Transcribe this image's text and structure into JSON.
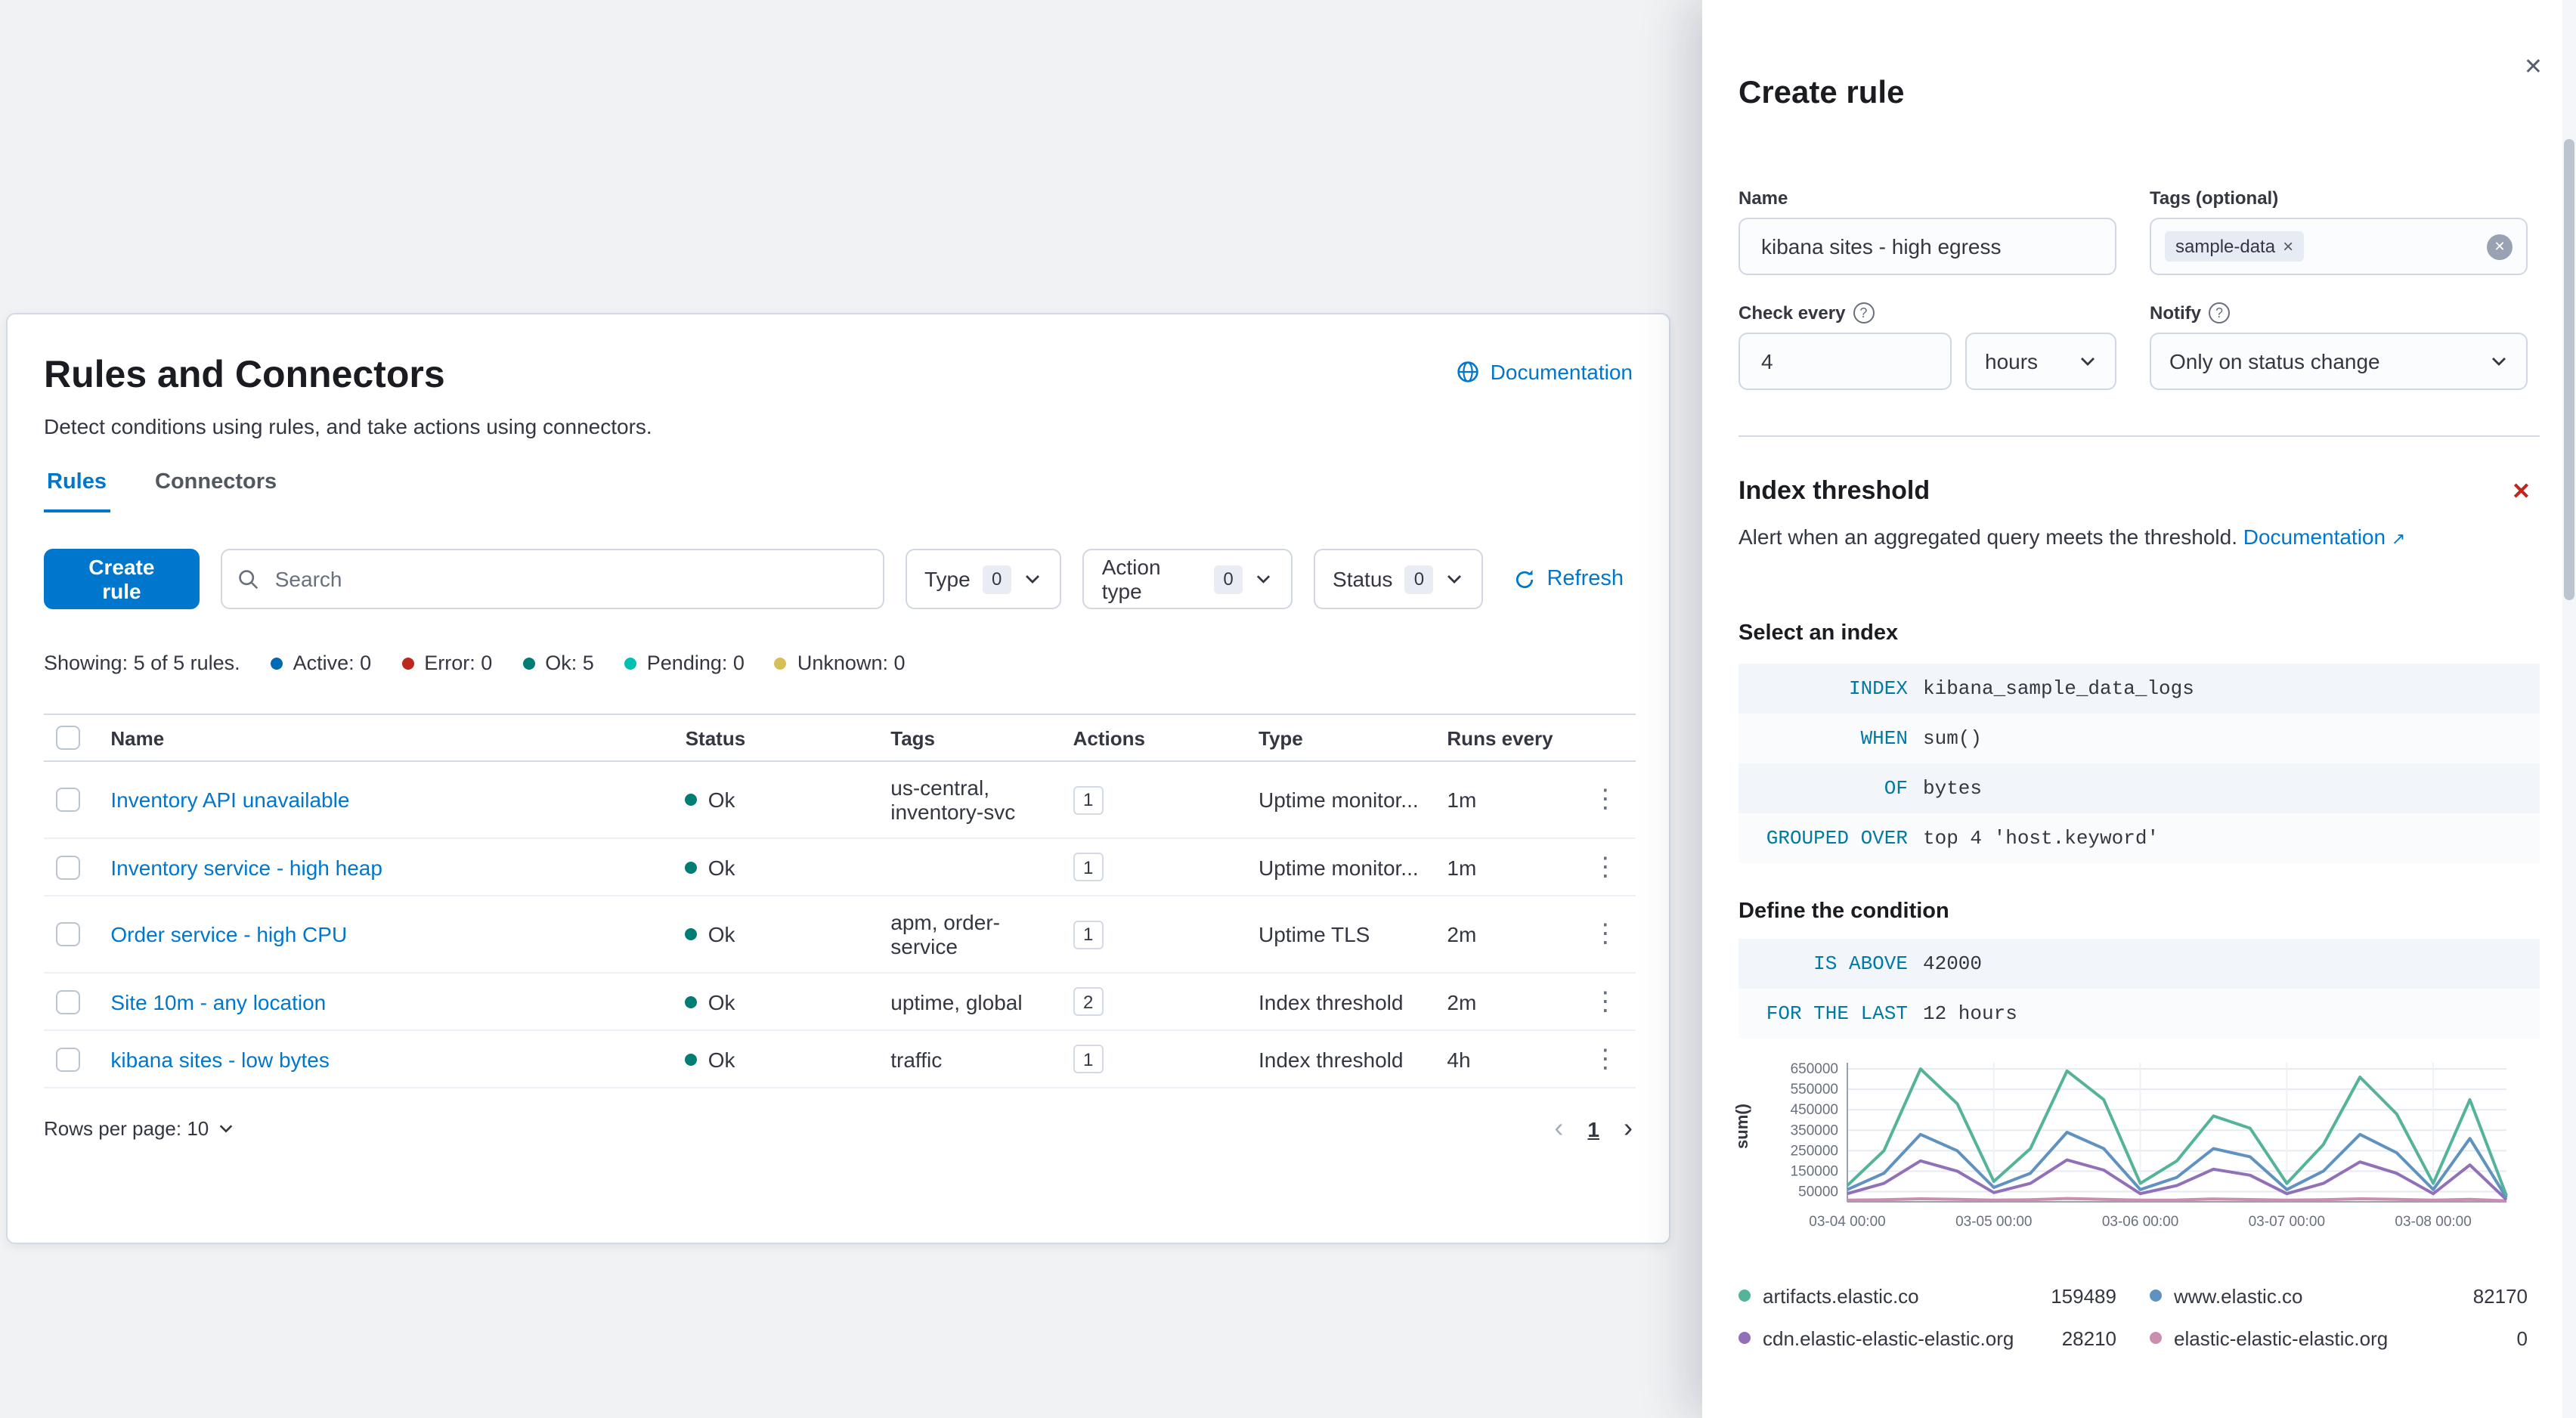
{
  "icons": {
    "close": "✕",
    "remove": "✕",
    "tag_remove": "×",
    "clear": "✕",
    "help": "?",
    "kebab": "⋮",
    "chevron_left": "‹",
    "chevron_right": "›",
    "external": "↗"
  },
  "page": {
    "title": "Rules and Connectors",
    "documentation_label": "Documentation",
    "subtitle": "Detect conditions using rules, and take actions using connectors.",
    "tabs": [
      {
        "label": "Rules"
      },
      {
        "label": "Connectors"
      }
    ],
    "create_rule_button": "Create rule",
    "search_placeholder": "Search",
    "filters": [
      {
        "label": "Type",
        "count": "0"
      },
      {
        "label": "Action type",
        "count": "0"
      },
      {
        "label": "Status",
        "count": "0"
      }
    ],
    "refresh_label": "Refresh",
    "summary": {
      "showing": "Showing: 5 of 5 rules.",
      "statuses": [
        {
          "label": "Active: 0",
          "color": "#006BB4"
        },
        {
          "label": "Error: 0",
          "color": "#BD271E"
        },
        {
          "label": "Ok: 5",
          "color": "#017D73"
        },
        {
          "label": "Pending: 0",
          "color": "#00BFB3"
        },
        {
          "label": "Unknown: 0",
          "color": "#D6BF57"
        }
      ]
    },
    "table": {
      "headers": [
        "Name",
        "Status",
        "Tags",
        "Actions",
        "Type",
        "Runs every"
      ],
      "rows": [
        {
          "name": "Inventory API unavailable",
          "status": "Ok",
          "tags": "us-central, inventory-svc",
          "actions": "1",
          "type": "Uptime monitor...",
          "runs_every": "1m"
        },
        {
          "name": "Inventory service - high heap",
          "status": "Ok",
          "tags": "",
          "actions": "1",
          "type": "Uptime monitor...",
          "runs_every": "1m"
        },
        {
          "name": "Order service - high CPU",
          "status": "Ok",
          "tags": "apm, order-service",
          "actions": "1",
          "type": "Uptime TLS",
          "runs_every": "2m"
        },
        {
          "name": "Site 10m - any location",
          "status": "Ok",
          "tags": "uptime, global",
          "actions": "2",
          "type": "Index threshold",
          "runs_every": "2m"
        },
        {
          "name": "kibana sites - low bytes",
          "status": "Ok",
          "tags": "traffic",
          "actions": "1",
          "type": "Index threshold",
          "runs_every": "4h"
        }
      ],
      "rows_per_page": "Rows per page: 10",
      "page_number": "1"
    }
  },
  "flyout": {
    "title": "Create rule",
    "name_label": "Name",
    "name_value": "kibana sites - high egress",
    "tags_label": "Tags (optional)",
    "tag_pill": "sample-data",
    "check_every_label": "Check every",
    "check_every_value": "4",
    "check_every_unit": "hours",
    "notify_label": "Notify",
    "notify_value": "Only on status change",
    "alert_type": {
      "title": "Index threshold",
      "description": "Alert when an aggregated query meets the threshold.",
      "documentation_label": "Documentation"
    },
    "select_index_label": "Select an index",
    "expressions": [
      {
        "keyword": "INDEX",
        "value": "kibana_sample_data_logs"
      },
      {
        "keyword": "WHEN",
        "value": "sum()"
      },
      {
        "keyword": "OF",
        "value": "bytes"
      },
      {
        "keyword": "GROUPED OVER",
        "value": "top 4 'host.keyword'"
      }
    ],
    "condition_label": "Define the condition",
    "condition_expressions": [
      {
        "keyword": "IS ABOVE",
        "value": "42000"
      },
      {
        "keyword": "FOR THE LAST",
        "value": "12 hours"
      }
    ]
  },
  "chart_data": {
    "type": "line",
    "ylabel": "sum()",
    "ylim": [
      0,
      680000
    ],
    "y_ticks": [
      50000,
      150000,
      250000,
      350000,
      450000,
      550000,
      650000
    ],
    "xlim": [
      0,
      108
    ],
    "x_tick_hours": [
      0,
      24,
      48,
      72,
      96
    ],
    "x_tick_labels": [
      "03-04 00:00",
      "03-05 00:00",
      "03-06 00:00",
      "03-07 00:00",
      "03-08 00:00"
    ],
    "x_hours": [
      0,
      6,
      12,
      18,
      24,
      30,
      36,
      42,
      48,
      54,
      60,
      66,
      72,
      78,
      84,
      90,
      96,
      102,
      108
    ],
    "series": [
      {
        "name": "artifacts.elastic.co",
        "color": "#54B399",
        "legend_value": "159489",
        "values": [
          80000,
          250000,
          650000,
          480000,
          100000,
          260000,
          640000,
          500000,
          90000,
          200000,
          420000,
          360000,
          90000,
          280000,
          610000,
          430000,
          90000,
          500000,
          30000
        ]
      },
      {
        "name": "www.elastic.co",
        "color": "#6092C0",
        "legend_value": "82170",
        "values": [
          60000,
          140000,
          330000,
          250000,
          70000,
          140000,
          340000,
          260000,
          60000,
          120000,
          260000,
          220000,
          60000,
          150000,
          330000,
          240000,
          60000,
          310000,
          20000
        ]
      },
      {
        "name": "cdn.elastic-elastic-elastic.org",
        "color": "#9170B8",
        "legend_value": "28210",
        "values": [
          40000,
          90000,
          200000,
          150000,
          45000,
          90000,
          205000,
          155000,
          40000,
          80000,
          160000,
          130000,
          40000,
          90000,
          195000,
          140000,
          40000,
          180000,
          10000
        ]
      },
      {
        "name": "elastic-elastic-elastic.org",
        "color": "#CA8EAE",
        "legend_value": "0",
        "values": [
          8000,
          10000,
          15000,
          12000,
          8000,
          10000,
          16000,
          12000,
          8000,
          9000,
          14000,
          11000,
          8000,
          10000,
          15000,
          12000,
          8000,
          12000,
          5000
        ]
      }
    ]
  }
}
